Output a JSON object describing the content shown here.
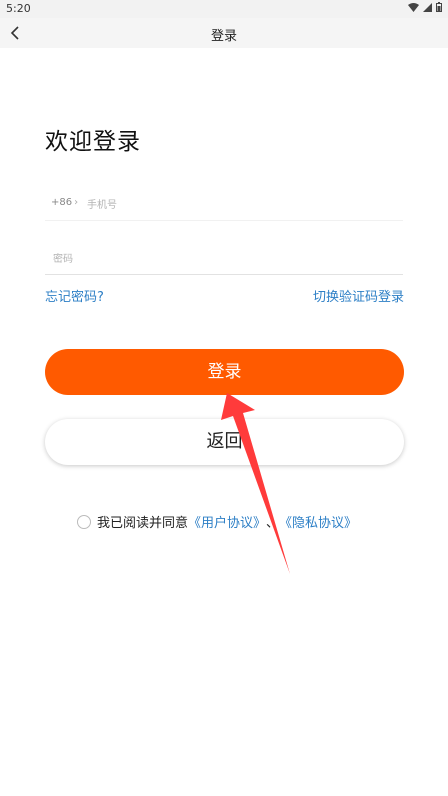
{
  "status": {
    "time": "5:20"
  },
  "appbar": {
    "title": "登录"
  },
  "welcome": "欢迎登录",
  "phone": {
    "prefix": "+86",
    "placeholder": "手机号"
  },
  "password": {
    "placeholder": "密码"
  },
  "links": {
    "forgot": "忘记密码?",
    "switch": "切换验证码登录"
  },
  "buttons": {
    "login": "登录",
    "back": "返回"
  },
  "agreement": {
    "text": "我已阅读并同意",
    "user_agreement": "《用户协议》",
    "separator": "、",
    "privacy": "《隐私协议》"
  },
  "colors": {
    "accent": "#ff5a00",
    "link": "#2d7fc6",
    "annotation_arrow": "#ff3b3b"
  }
}
